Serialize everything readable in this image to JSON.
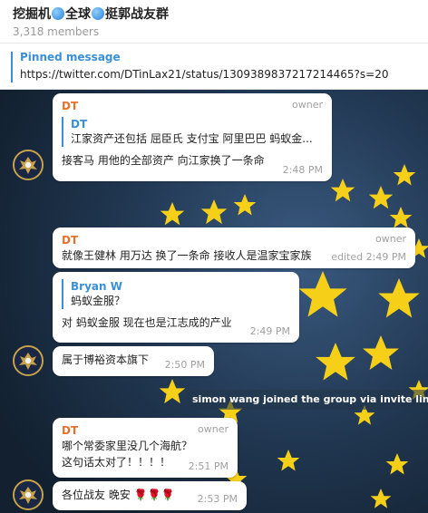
{
  "header": {
    "title_part1": "挖掘机",
    "title_part2": "全球",
    "title_part3": "挺郭战友群",
    "members": "3,318 members"
  },
  "pinned": {
    "label": "Pinned message",
    "text": "https://twitter.com/DTinLax21/status/1309389837217214465?s=20"
  },
  "messages": [
    {
      "sender": "DT",
      "role": "owner",
      "reply_name": "DT",
      "reply_text": "江家资产还包括 屈臣氏 支付宝 阿里巴巴 蚂蚁金...",
      "text": "接客马 用他的全部资产 向江家换了一条命",
      "time": "2:48 PM"
    },
    {
      "sender": "DT",
      "role": "owner",
      "text": "就像王健林 用万达 换了一条命 接收人是温家宝家族",
      "time": "edited 2:49 PM"
    },
    {
      "reply_name": "Bryan W",
      "reply_text": "蚂蚁金服？",
      "text": "对 蚂蚁金服 现在也是江志成的产业",
      "time": "2:49 PM"
    },
    {
      "text": "属于博裕资本旗下",
      "time": "2:50 PM"
    },
    {
      "sender": "DT",
      "role": "owner",
      "text_line1": "哪个常委家里没几个海航？",
      "text_line2": "这句话太对了！！！！",
      "time": "2:51 PM"
    },
    {
      "text": "各位战友 晚安",
      "emoji": "🌹🌹🌹",
      "time": "2:53 PM"
    }
  ],
  "service_message": "simon wang joined the group via invite link"
}
